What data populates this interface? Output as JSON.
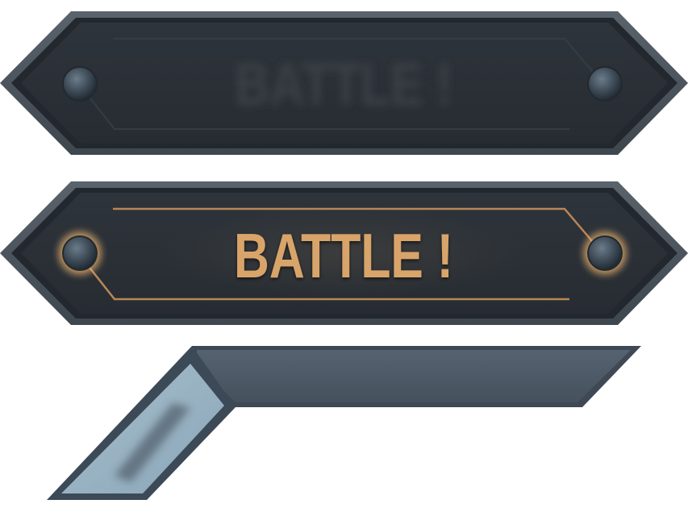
{
  "buttons": {
    "battle_disabled": {
      "label": "BATTLE !",
      "state": "disabled"
    },
    "battle_active": {
      "label": "BATTLE !",
      "state": "active"
    }
  },
  "colors": {
    "frame_outer": "#4a535c",
    "frame_inner": "#262b31",
    "panel": "#2b3038",
    "circuit_off": "#3a4146",
    "accent": "#d9a46a",
    "rivet": "#3b4854",
    "ribbon_dark": "#4a5663",
    "ribbon_light": "#9cb4c4"
  }
}
